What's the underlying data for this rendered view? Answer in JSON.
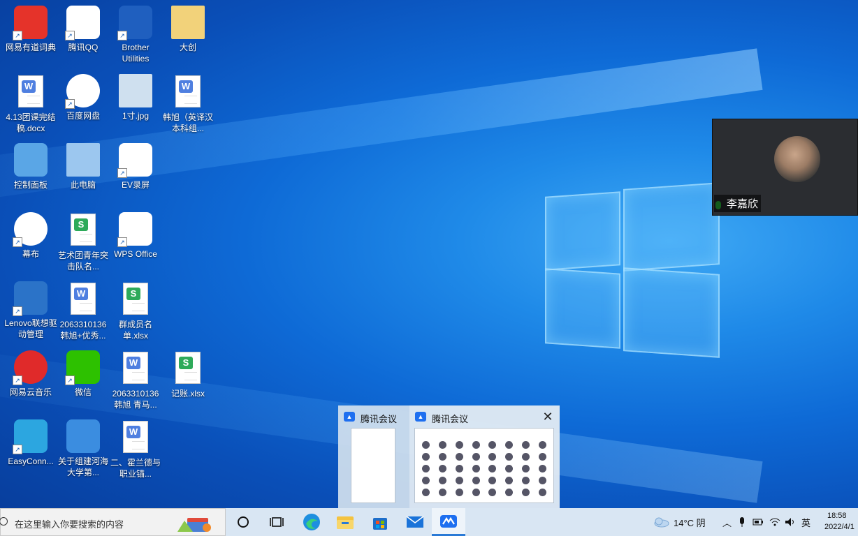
{
  "desktop": {
    "icons": [
      {
        "label": "网易有道词典",
        "icon": "youdao-dict-icon"
      },
      {
        "label": "腾讯QQ",
        "icon": "qq-icon"
      },
      {
        "label": "Brother Utilities",
        "icon": "brother-utilities-icon"
      },
      {
        "label": "大创",
        "icon": "folder-icon"
      },
      {
        "label": "4.13团课完结稿.docx",
        "icon": "word-doc-icon"
      },
      {
        "label": "百度网盘",
        "icon": "baidu-netdisk-icon"
      },
      {
        "label": "1寸.jpg",
        "icon": "photo-icon"
      },
      {
        "label": "韩旭（英译汉本科组...",
        "icon": "word-doc-icon"
      },
      {
        "label": "控制面板",
        "icon": "control-panel-icon"
      },
      {
        "label": "此电脑",
        "icon": "this-pc-icon"
      },
      {
        "label": "EV录屏",
        "icon": "ev-recorder-icon"
      },
      {
        "label": "幕布",
        "icon": "mubu-icon"
      },
      {
        "label": "艺术团青年突击队名...",
        "icon": "spreadsheet-icon"
      },
      {
        "label": "WPS Office",
        "icon": "wps-icon"
      },
      {
        "label": "Lenovo联想驱动管理",
        "icon": "lenovo-driver-icon"
      },
      {
        "label": "2063310136韩旭+优秀...",
        "icon": "word-doc-icon"
      },
      {
        "label": "群成员名单.xlsx",
        "icon": "spreadsheet-icon"
      },
      {
        "label": "网易云音乐",
        "icon": "netease-music-icon"
      },
      {
        "label": "微信",
        "icon": "wechat-icon"
      },
      {
        "label": "2063310136韩旭 青马...",
        "icon": "word-doc-icon"
      },
      {
        "label": "记账.xlsx",
        "icon": "spreadsheet-icon"
      },
      {
        "label": "EasyConn...",
        "icon": "easyconnect-icon"
      },
      {
        "label": "关于组建河海大学第...",
        "icon": "zip-archive-icon"
      },
      {
        "label": "二、霍兰德与职业锚...",
        "icon": "word-doc-icon"
      }
    ]
  },
  "video_tile": {
    "participant_name": "李嘉欣"
  },
  "thumbnails": {
    "window1_title": "腾讯会议",
    "window2_title": "腾讯会议"
  },
  "taskbar": {
    "search_placeholder": "在这里输入你要搜索的内容",
    "apps": [
      "cortana-icon",
      "task-view-icon",
      "edge-icon",
      "file-explorer-icon",
      "store-icon",
      "mail-icon",
      "tencent-meeting-icon"
    ],
    "weather": "14°C 阴",
    "ime": "英",
    "time": "18:58",
    "date": "2022/4/1"
  },
  "colors": {
    "accent": "#2a7ad6",
    "desktop_blue": "#0e6ad6"
  }
}
